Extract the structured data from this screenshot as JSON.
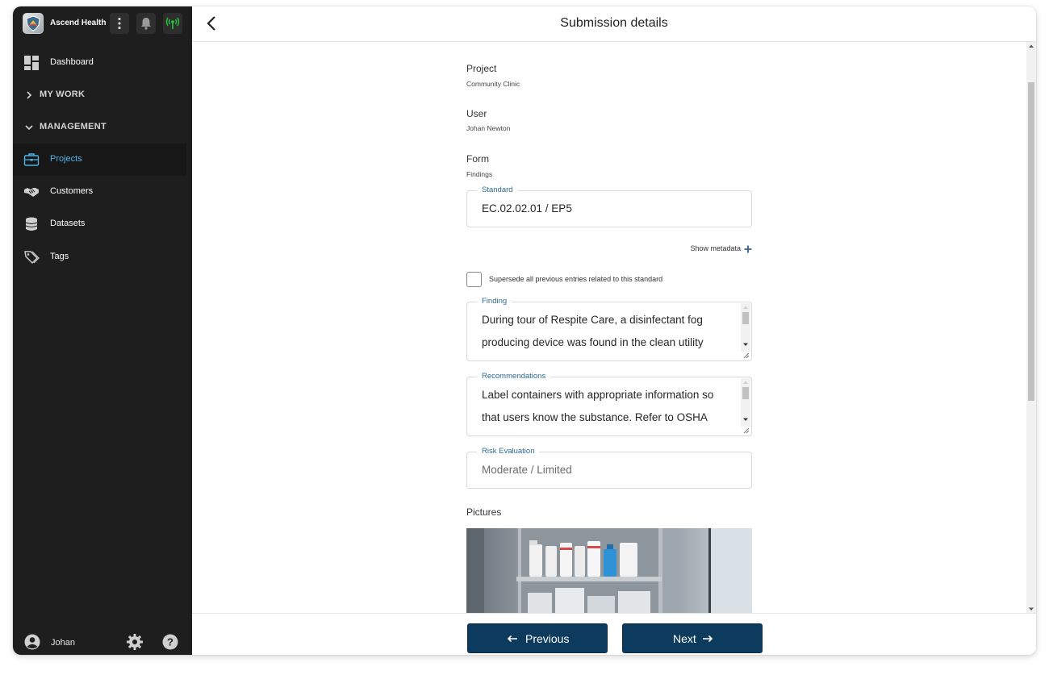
{
  "app": {
    "name": "Ascend Health",
    "user_name": "Johan"
  },
  "sidebar": {
    "items": [
      {
        "label": "Dashboard",
        "icon": "dashboard-icon"
      },
      {
        "label": "MY WORK",
        "icon": "chevron-right-icon",
        "section": true,
        "expanded": false
      },
      {
        "label": "MANAGEMENT",
        "icon": "chevron-down-icon",
        "section": true,
        "expanded": true
      },
      {
        "label": "Projects",
        "icon": "briefcase-icon",
        "active": true
      },
      {
        "label": "Customers",
        "icon": "handshake-icon"
      },
      {
        "label": "Datasets",
        "icon": "database-icon"
      },
      {
        "label": "Tags",
        "icon": "tags-icon"
      }
    ]
  },
  "header": {
    "title": "Submission details"
  },
  "details": {
    "project_label": "Project",
    "project_value": "Community Clinic",
    "user_label": "User",
    "user_value": "Johan Newton",
    "form_label": "Form",
    "form_value": "Findings"
  },
  "standard": {
    "label": "Standard",
    "value": "EC.02.02.01 / EP5",
    "show_metadata": "Show metadata"
  },
  "supersede": {
    "label": "Supersede all previous entries related to this standard",
    "checked": false
  },
  "finding": {
    "label": "Finding",
    "value": "During tour of Respite Care, a disinfectant fog producing device was found in the clean utility room without a label on the container"
  },
  "recommendations": {
    "label": "Recommendations",
    "value": "Label containers with appropriate information so that users know the substance.  Refer to OSHA standards."
  },
  "risk": {
    "label": "Risk Evaluation",
    "value": "Moderate / Limited"
  },
  "pictures": {
    "label": "Pictures"
  },
  "footer": {
    "previous_label": "Previous",
    "next_label": "Next"
  },
  "colors": {
    "sidebar_bg": "#1e1e1e",
    "active_nav_text": "#4fb3e8",
    "primary_button": "#0d3b5e",
    "field_label_accent": "#2b6a8e",
    "signal_icon": "#27c93f"
  }
}
